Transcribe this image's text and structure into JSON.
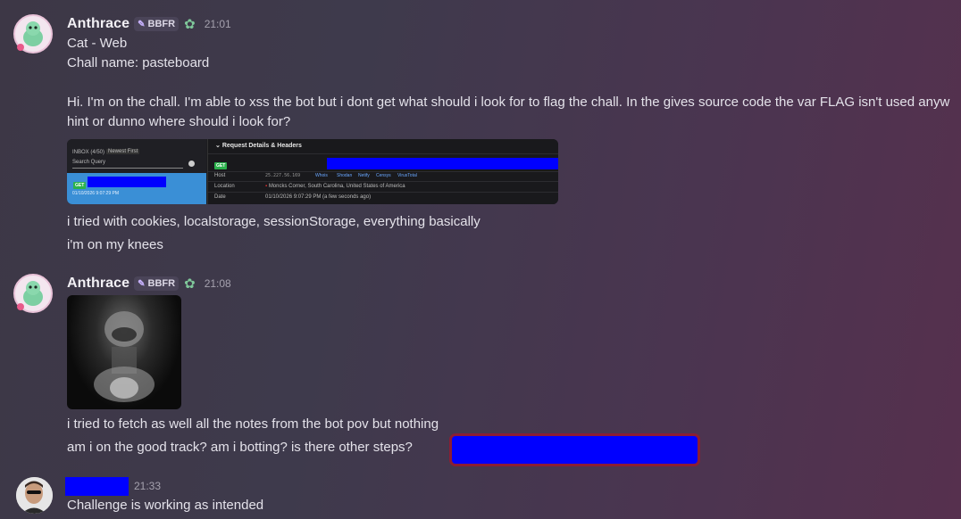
{
  "messages": [
    {
      "username": "Anthrace",
      "tag": "BBFR",
      "time": "21:01",
      "lines": [
        "Cat - Web",
        "Chall name: pasteboard",
        "Hi. I'm on the chall. I'm able to xss the bot but i dont get what should i look for to flag the chall. In the gives source code the var FLAG  isn't used anyw",
        "hint or dunno where should i look for?"
      ],
      "attachment": {
        "inbox_label": "INBOX (4/50)",
        "sort_label": "Newest First",
        "search_placeholder": "Search Query",
        "method": "GET",
        "request_time": "01/10/2026 9:07:29 PM",
        "panel_title": "Request Details & Headers",
        "host_label": "Host",
        "host_value": "25.227.56.169",
        "host_links": [
          "Whois",
          "Shodan",
          "Netify",
          "Censys",
          "VirusTotal"
        ],
        "location_label": "Location",
        "location_value": "Moncks Corner, South Carolina, United States of America",
        "date_label": "Date",
        "date_value": "01/10/2026 9:07:29 PM (a few seconds ago)"
      },
      "after_lines": [
        "i tried with cookies, localstorage, sessionStorage, everything basically",
        "i'm on my knees"
      ]
    },
    {
      "username": "Anthrace",
      "tag": "BBFR",
      "time": "21:08",
      "lines": [
        "i tried to fetch as well all the notes from the bot pov but nothing",
        "am i on the good track? am i botting? is there other steps?"
      ]
    },
    {
      "username": "",
      "time": "21:33",
      "lines": [
        "Challenge is working as intended"
      ]
    }
  ],
  "colors": {
    "redaction": "#0000ff",
    "highlight_border": "#8b1d34",
    "get_badge": "#2bb24c",
    "selected_row": "#3a8fd6"
  }
}
